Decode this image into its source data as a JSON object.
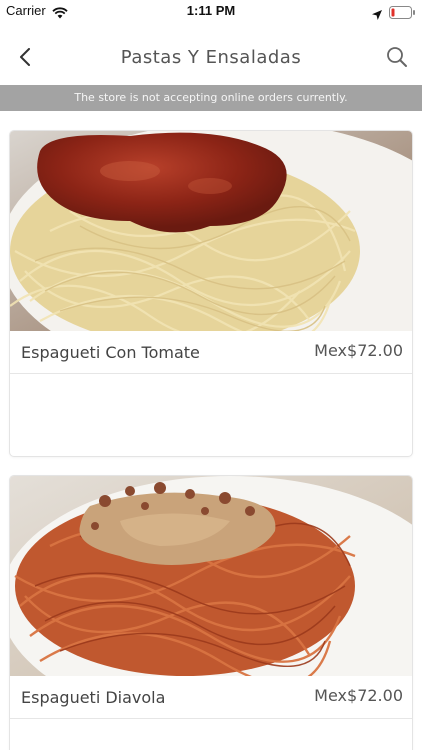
{
  "status_bar": {
    "carrier": "Carrier",
    "time": "1:11 PM",
    "icons": [
      "wifi-icon",
      "location-icon",
      "battery-icon"
    ]
  },
  "nav": {
    "title": "Pastas Y Ensaladas",
    "back_icon": "chevron-left-icon",
    "search_icon": "search-icon"
  },
  "notice": {
    "text": "The store is not accepting online orders currently."
  },
  "products": [
    {
      "name": "Espagueti Con Tomate",
      "price": "Mex$72.00",
      "image": "spaghetti-tomato-photo"
    },
    {
      "name": "Espagueti Diavola",
      "price": "Mex$72.00",
      "image": "spaghetti-diavola-photo"
    }
  ],
  "colors": {
    "notice_background": "#a3a3a3",
    "battery_low": "#e0302a",
    "text_primary": "#444444"
  }
}
